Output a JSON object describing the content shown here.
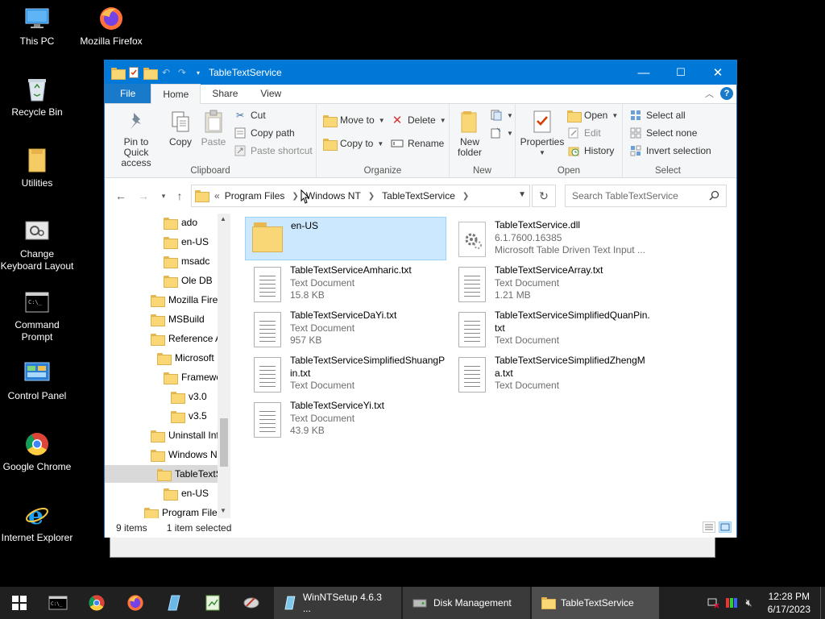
{
  "desktop": {
    "icons": [
      {
        "label": "This PC",
        "icon": "this-pc-icon"
      },
      {
        "label": "Mozilla Firefox",
        "icon": "firefox-icon"
      },
      {
        "label": "Recycle Bin",
        "icon": "recycle-bin-icon"
      },
      {
        "label": "Utilities",
        "icon": "folder-icon"
      },
      {
        "label": "Change Keyboard Layout",
        "icon": "keyboard-settings-icon"
      },
      {
        "label": "Command Prompt",
        "icon": "cmd-icon"
      },
      {
        "label": "Control Panel",
        "icon": "control-panel-icon"
      },
      {
        "label": "Google Chrome",
        "icon": "chrome-icon"
      },
      {
        "label": "Internet Explorer",
        "icon": "ie-icon"
      }
    ]
  },
  "window": {
    "title": "TableTextService",
    "controls": {
      "minimize": "—",
      "maximize": "☐",
      "close": "✕"
    }
  },
  "ribbon": {
    "tabs": [
      "File",
      "Home",
      "Share",
      "View"
    ],
    "active_tab": "Home",
    "clipboard": {
      "pin_label_1": "Pin to Quick",
      "pin_label_2": "access",
      "copy": "Copy",
      "paste": "Paste",
      "cut": "Cut",
      "copy_path": "Copy path",
      "paste_shortcut": "Paste shortcut",
      "group": "Clipboard"
    },
    "organize": {
      "move_to": "Move to",
      "copy_to": "Copy to",
      "delete": "Delete",
      "rename": "Rename",
      "group": "Organize"
    },
    "new": {
      "new_folder_1": "New",
      "new_folder_2": "folder",
      "group": "New"
    },
    "open": {
      "properties": "Properties",
      "open": "Open",
      "edit": "Edit",
      "history": "History",
      "group": "Open"
    },
    "select": {
      "select_all": "Select all",
      "select_none": "Select none",
      "invert": "Invert selection",
      "group": "Select"
    }
  },
  "address": {
    "overflow": "«",
    "crumbs": [
      "Program Files",
      "Windows NT",
      "TableTextService"
    ],
    "search_placeholder": "Search TableTextService"
  },
  "nav_pane": {
    "items": [
      {
        "label": "ado"
      },
      {
        "label": "en-US"
      },
      {
        "label": "msadc"
      },
      {
        "label": "Ole DB"
      },
      {
        "label": "Mozilla Firef"
      },
      {
        "label": "MSBuild"
      },
      {
        "label": "Reference A"
      },
      {
        "label": "Microsoft"
      },
      {
        "label": "Framewo"
      },
      {
        "label": "v3.0"
      },
      {
        "label": "v3.5"
      },
      {
        "label": "Uninstall Inf"
      },
      {
        "label": "Windows N"
      },
      {
        "label": "TableTextS"
      },
      {
        "label": "en-US"
      },
      {
        "label": "Program Files"
      }
    ],
    "selected": "TableTextS"
  },
  "files": [
    {
      "name": "en-US",
      "line2": "",
      "line3": "",
      "kind": "folder"
    },
    {
      "name": "TableTextService.dll",
      "line2": "6.1.7600.16385",
      "line3": "Microsoft Table Driven Text Input ...",
      "kind": "dll"
    },
    {
      "name": "TableTextServiceAmharic.txt",
      "line2": "Text Document",
      "line3": "15.8 KB",
      "kind": "txt"
    },
    {
      "name": "TableTextServiceArray.txt",
      "line2": "Text Document",
      "line3": "1.21 MB",
      "kind": "txt"
    },
    {
      "name": "TableTextServiceDaYi.txt",
      "line2": "Text Document",
      "line3": "957 KB",
      "kind": "txt"
    },
    {
      "name": "TableTextServiceSimplifiedQuanPin.",
      "name2": "txt",
      "line2": "Text Document",
      "line3": "",
      "kind": "txt"
    },
    {
      "name": "TableTextServiceSimplifiedShuangP",
      "name2": "in.txt",
      "line2": "Text Document",
      "line3": "",
      "kind": "txt"
    },
    {
      "name": "TableTextServiceSimplifiedZhengM",
      "name2": "a.txt",
      "line2": "Text Document",
      "line3": "",
      "kind": "txt"
    },
    {
      "name": "TableTextServiceYi.txt",
      "line2": "Text Document",
      "line3": "43.9 KB",
      "kind": "txt"
    }
  ],
  "status": {
    "count": "9 items",
    "selected": "1 item selected"
  },
  "taskbar": {
    "apps": [
      {
        "label": "WinNTSetup 4.6.3  ..."
      },
      {
        "label": "Disk Management"
      },
      {
        "label": "TableTextService"
      }
    ],
    "time": "12:28 PM",
    "date": "6/17/2023"
  },
  "colors": {
    "accent": "#0078d7",
    "selection": "#cce8ff",
    "taskbar": "#202020"
  }
}
